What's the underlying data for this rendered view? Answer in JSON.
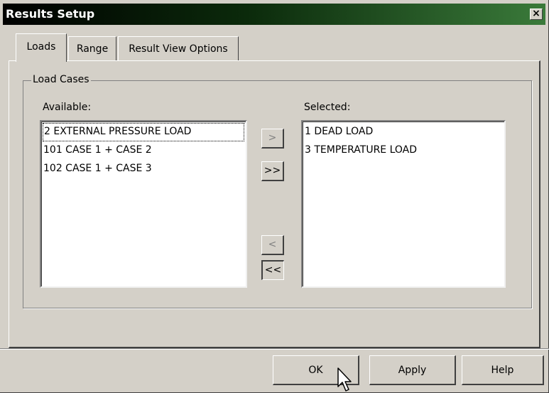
{
  "window": {
    "title": "Results Setup",
    "close_label": "×"
  },
  "tabs": [
    {
      "label": "Loads",
      "active": true
    },
    {
      "label": "Range",
      "active": false
    },
    {
      "label": "Result View Options",
      "active": false
    }
  ],
  "load_cases": {
    "group_label": "Load Cases",
    "available_label": "Available:",
    "selected_label": "Selected:",
    "available": [
      "2 EXTERNAL PRESSURE LOAD",
      "101 CASE 1 + CASE 2",
      "102 CASE 1 + CASE 3"
    ],
    "selected": [
      "1 DEAD LOAD",
      "3 TEMPERATURE LOAD"
    ]
  },
  "transfer_buttons": {
    "add": ">",
    "add_all": ">>",
    "remove": "<",
    "remove_all": "<<"
  },
  "footer_buttons": {
    "ok": "OK",
    "apply": "Apply",
    "help": "Help"
  }
}
